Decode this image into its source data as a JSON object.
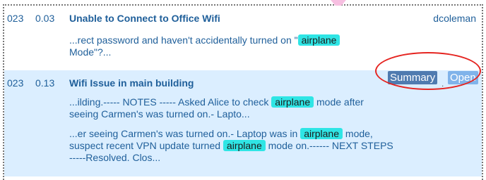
{
  "results": [
    {
      "date": "023",
      "score": "0.03",
      "title": "Unable to Connect to Office Wifi",
      "user": "dcoleman",
      "snippets": [
        {
          "before": "...rect password and haven't accidentally turned on \"",
          "highlight": "airplane",
          "after": "Mode\"?..."
        }
      ]
    },
    {
      "date": "023",
      "score": "0.13",
      "title": "Wifi Issue in main building",
      "actions": {
        "summary": "Summary",
        "open": "Open",
        "separator": "."
      },
      "snippets": [
        {
          "before": "...ilding.----- NOTES ----- Asked Alice to check ",
          "highlight": "airplane",
          "after": " mode after seeing Carmen's was turned on.- Lapto..."
        },
        {
          "before": "...er seeing Carmen's was turned on.- Laptop was in ",
          "highlight": "airplane",
          "after": " mode, suspect recent VPN update turned ",
          "highlight2": "airplane",
          "after2": " mode on.------ NEXT STEPS -----Resolved. Clos..."
        }
      ]
    }
  ],
  "colors": {
    "link": "#1f5f9a",
    "highlight": "#2fe5e5",
    "row_highlight": "#dbeeff",
    "summary_button": "#4f7bb0",
    "open_button": "#80b3ea",
    "annotation_ring": "#e52521",
    "pointer": "#f7bfe1"
  }
}
